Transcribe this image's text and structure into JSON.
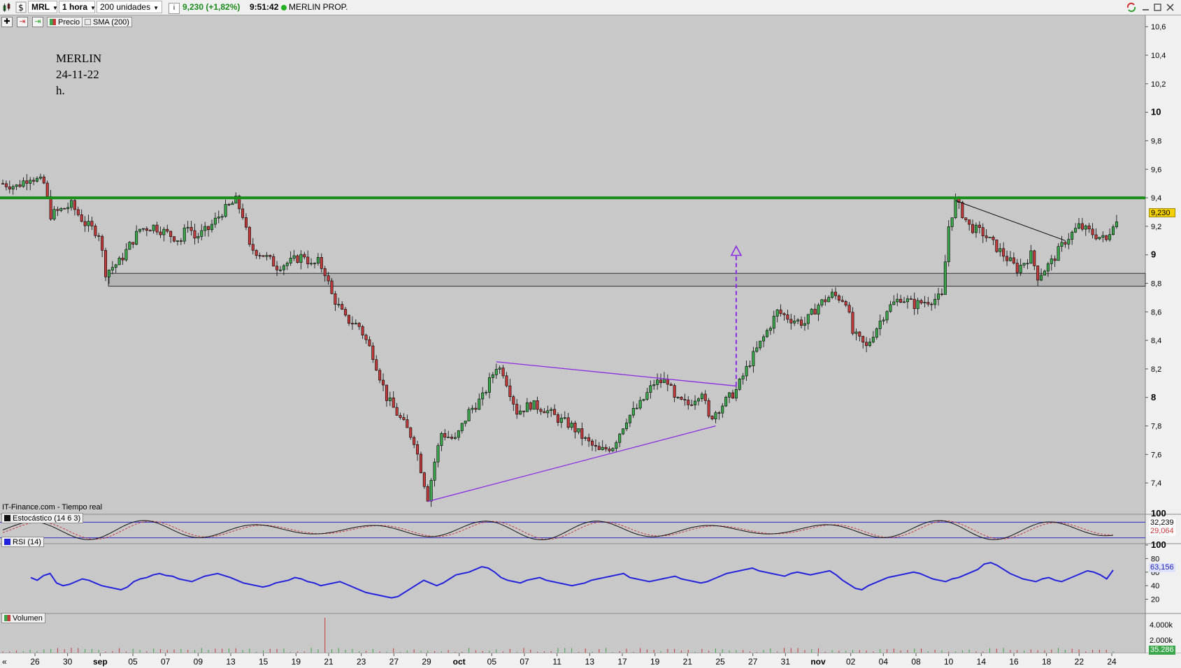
{
  "toolbar": {
    "symbol": "MRL",
    "interval": "1 hora",
    "units": "200 unidades",
    "info_icon": "i",
    "quote": "9,230 (+1,82%)",
    "time": "9:51:42",
    "name": "MERLIN PROP."
  },
  "chips": {
    "price": "Precio",
    "sma": "SMA (200)",
    "stochastic": "Estocástico (14 6 3)",
    "rsi": "RSI (14)",
    "volume": "Volumen"
  },
  "annotation": {
    "line1": "MERLIN",
    "line2": "24-11-22",
    "line3": "h."
  },
  "source": "IT-Finance.com - Tiempo real",
  "tags": {
    "price": "9,230",
    "stoch_k": "32,239",
    "stoch_d": "29,064",
    "rsi": "63,156",
    "volume": "35.286"
  },
  "colors": {
    "resistance": "#1a8f1a",
    "triangle": "#8a2be2",
    "rsi": "#2222dd",
    "bull": "#3aa84a",
    "bear": "#c43a3a",
    "band": "#b4b4b4"
  },
  "icons": [
    "candlestick-chart-icon",
    "dollar-icon",
    "info-icon",
    "status-dot-icon",
    "refresh-icon",
    "minimize-icon",
    "maximize-icon",
    "close-icon",
    "add-icon",
    "remove-icon",
    "export-icon",
    "scroll-left-icon"
  ],
  "chart_data": {
    "type": "candlestick",
    "title": "MERLIN 24-11-22 h.",
    "price_axis": {
      "ylim": [
        7.2,
        10.65
      ],
      "ticks": [
        "10,6",
        "10,4",
        "10,2",
        "10",
        "9,8",
        "9,6",
        "9,4",
        "9,2",
        "9",
        "8,8",
        "8,6",
        "8,4",
        "8,2",
        "8",
        "7,8",
        "7,6",
        "7,4"
      ]
    },
    "x_ticks": [
      {
        "label": "26",
        "bold": false
      },
      {
        "label": "30",
        "bold": false
      },
      {
        "label": "sep",
        "bold": true
      },
      {
        "label": "05",
        "bold": false
      },
      {
        "label": "07",
        "bold": false
      },
      {
        "label": "09",
        "bold": false
      },
      {
        "label": "13",
        "bold": false
      },
      {
        "label": "15",
        "bold": false
      },
      {
        "label": "19",
        "bold": false
      },
      {
        "label": "21",
        "bold": false
      },
      {
        "label": "23",
        "bold": false
      },
      {
        "label": "27",
        "bold": false
      },
      {
        "label": "29",
        "bold": false
      },
      {
        "label": "oct",
        "bold": true
      },
      {
        "label": "05",
        "bold": false
      },
      {
        "label": "07",
        "bold": false
      },
      {
        "label": "11",
        "bold": false
      },
      {
        "label": "13",
        "bold": false
      },
      {
        "label": "17",
        "bold": false
      },
      {
        "label": "19",
        "bold": false
      },
      {
        "label": "21",
        "bold": false
      },
      {
        "label": "25",
        "bold": false
      },
      {
        "label": "27",
        "bold": false
      },
      {
        "label": "31",
        "bold": false
      },
      {
        "label": "nov",
        "bold": true
      },
      {
        "label": "02",
        "bold": false
      },
      {
        "label": "04",
        "bold": false
      },
      {
        "label": "08",
        "bold": false
      },
      {
        "label": "10",
        "bold": false
      },
      {
        "label": "14",
        "bold": false
      },
      {
        "label": "16",
        "bold": false
      },
      {
        "label": "18",
        "bold": false
      },
      {
        "label": "22",
        "bold": false
      },
      {
        "label": "24",
        "bold": false
      }
    ],
    "close_path": [
      [
        0,
        9.5
      ],
      [
        2,
        9.48
      ],
      [
        4,
        9.55
      ],
      [
        6,
        9.5
      ],
      [
        7,
        9.28
      ],
      [
        10,
        9.35
      ],
      [
        12,
        9.22
      ],
      [
        14,
        9.15
      ],
      [
        15,
        8.88
      ],
      [
        17,
        8.95
      ],
      [
        20,
        9.18
      ],
      [
        22,
        9.2
      ],
      [
        24,
        9.15
      ],
      [
        26,
        9.1
      ],
      [
        27,
        9.22
      ],
      [
        28,
        9.12
      ],
      [
        30,
        9.18
      ],
      [
        32,
        9.3
      ],
      [
        34,
        9.38
      ],
      [
        35,
        9.28
      ],
      [
        36,
        9.05
      ],
      [
        38,
        9.0
      ],
      [
        40,
        8.92
      ],
      [
        42,
        8.95
      ],
      [
        44,
        9.0
      ],
      [
        45,
        8.92
      ],
      [
        46,
        8.95
      ],
      [
        47,
        8.88
      ],
      [
        48,
        8.72
      ],
      [
        50,
        8.55
      ],
      [
        52,
        8.5
      ],
      [
        54,
        8.3
      ],
      [
        56,
        8.0
      ],
      [
        58,
        7.85
      ],
      [
        60,
        7.7
      ],
      [
        61,
        7.5
      ],
      [
        62,
        7.3
      ],
      [
        63,
        7.55
      ],
      [
        64,
        7.75
      ],
      [
        66,
        7.7
      ],
      [
        68,
        7.9
      ],
      [
        70,
        8.0
      ],
      [
        72,
        8.22
      ],
      [
        73,
        8.18
      ],
      [
        75,
        7.9
      ],
      [
        77,
        7.95
      ],
      [
        79,
        7.92
      ],
      [
        81,
        7.85
      ],
      [
        83,
        7.8
      ],
      [
        85,
        7.7
      ],
      [
        87,
        7.62
      ],
      [
        89,
        7.66
      ],
      [
        91,
        7.85
      ],
      [
        93,
        7.95
      ],
      [
        95,
        8.1
      ],
      [
        97,
        8.12
      ],
      [
        98,
        7.98
      ],
      [
        100,
        7.95
      ],
      [
        102,
        8.05
      ],
      [
        103,
        7.85
      ],
      [
        105,
        7.95
      ],
      [
        107,
        8.05
      ],
      [
        108,
        8.15
      ],
      [
        109,
        8.25
      ],
      [
        111,
        8.42
      ],
      [
        113,
        8.6
      ],
      [
        115,
        8.55
      ],
      [
        117,
        8.52
      ],
      [
        119,
        8.65
      ],
      [
        121,
        8.72
      ],
      [
        123,
        8.68
      ],
      [
        124,
        8.45
      ],
      [
        126,
        8.35
      ],
      [
        127,
        8.45
      ],
      [
        129,
        8.62
      ],
      [
        131,
        8.7
      ],
      [
        133,
        8.65
      ],
      [
        135,
        8.68
      ],
      [
        137,
        8.7
      ],
      [
        138,
        9.2
      ],
      [
        139,
        9.38
      ],
      [
        141,
        9.2
      ],
      [
        143,
        9.15
      ],
      [
        145,
        9.05
      ],
      [
        147,
        8.95
      ],
      [
        148,
        8.9
      ],
      [
        150,
        9.0
      ],
      [
        151,
        8.85
      ],
      [
        153,
        8.95
      ],
      [
        155,
        9.1
      ],
      [
        157,
        9.2
      ],
      [
        159,
        9.15
      ],
      [
        161,
        9.1
      ],
      [
        162,
        9.23
      ]
    ],
    "resistance": 9.4,
    "support_zone": [
      8.78,
      8.87
    ],
    "triangle": {
      "upper": [
        [
          72,
          8.25
        ],
        [
          107,
          8.08
        ]
      ],
      "lower": [
        [
          62,
          7.27
        ],
        [
          104,
          7.8
        ]
      ]
    },
    "target_arrow": {
      "x": 107,
      "from": 8.08,
      "to": 9.05
    },
    "downtrend": [
      [
        139,
        9.38
      ],
      [
        155,
        9.1
      ]
    ],
    "stochastic": {
      "ylim": [
        0,
        100
      ],
      "ticks": [
        "100"
      ],
      "overbought": 80,
      "oversold": 20
    },
    "rsi": {
      "ylim": [
        0,
        100
      ],
      "ticks": [
        "100",
        "80",
        "60",
        "40",
        "20"
      ],
      "values": [
        52,
        48,
        55,
        58,
        44,
        40,
        42,
        46,
        50,
        48,
        44,
        40,
        38,
        36,
        34,
        38,
        46,
        50,
        52,
        56,
        58,
        55,
        54,
        50,
        48,
        46,
        50,
        54,
        56,
        58,
        55,
        52,
        48,
        44,
        42,
        40,
        38,
        40,
        44,
        46,
        48,
        52,
        50,
        46,
        44,
        40,
        42,
        44,
        46,
        42,
        38,
        34,
        30,
        28,
        26,
        24,
        22,
        24,
        30,
        36,
        42,
        48,
        44,
        40,
        44,
        50,
        56,
        58,
        60,
        64,
        68,
        66,
        60,
        52,
        48,
        46,
        44,
        48,
        50,
        52,
        48,
        46,
        44,
        42,
        40,
        42,
        44,
        48,
        50,
        52,
        54,
        56,
        58,
        52,
        50,
        48,
        46,
        48,
        50,
        52,
        54,
        50,
        48,
        46,
        44,
        46,
        50,
        54,
        58,
        60,
        62,
        64,
        66,
        62,
        60,
        58,
        56,
        54,
        58,
        60,
        58,
        56,
        58,
        60,
        62,
        56,
        48,
        42,
        36,
        34,
        40,
        44,
        48,
        52,
        54,
        56,
        58,
        60,
        58,
        54,
        50,
        48,
        46,
        50,
        52,
        56,
        60,
        64,
        72,
        74,
        70,
        64,
        58,
        54,
        50,
        48,
        46,
        50,
        52,
        48,
        46,
        50,
        54,
        58,
        62,
        60,
        56,
        50,
        63
      ]
    },
    "volume": {
      "ticks": [
        "4.000k",
        "2.000k"
      ],
      "spike_index": 47
    }
  }
}
